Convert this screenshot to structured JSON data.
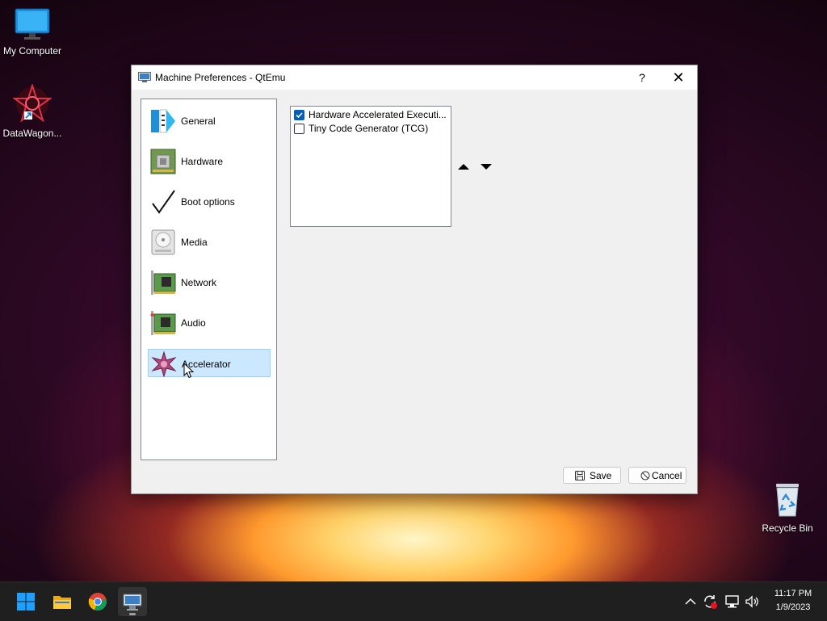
{
  "desktop": {
    "icons": [
      {
        "label": "My Computer"
      },
      {
        "label": "DataWagon..."
      },
      {
        "label": "Recycle Bin"
      }
    ]
  },
  "window": {
    "title": "Machine Preferences - QtEmu",
    "help_glyph": "?",
    "close_glyph": "✕",
    "nav": [
      {
        "label": "General",
        "icon": "general-icon"
      },
      {
        "label": "Hardware",
        "icon": "hardware-icon"
      },
      {
        "label": "Boot options",
        "icon": "checkmark-icon"
      },
      {
        "label": "Media",
        "icon": "drive-icon"
      },
      {
        "label": "Network",
        "icon": "network-card-icon"
      },
      {
        "label": "Audio",
        "icon": "audio-card-icon"
      },
      {
        "label": "Accelerator",
        "icon": "accelerator-star-icon",
        "selected": true
      }
    ],
    "accelerators": [
      {
        "label": "Hardware Accelerated Executi...",
        "checked": true
      },
      {
        "label": "Tiny Code Generator (TCG)",
        "checked": false
      }
    ],
    "buttons": {
      "save": "Save",
      "cancel": "Cancel"
    }
  },
  "taskbar": {
    "time": "11:17 PM",
    "date": "1/9/2023"
  },
  "colors": {
    "accent": "#005fb8",
    "selection": "#cce8ff"
  }
}
